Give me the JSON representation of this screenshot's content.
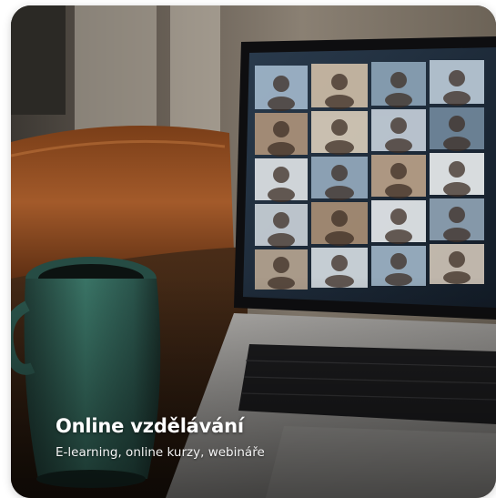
{
  "card": {
    "title": "Online vzdělávání",
    "subtitle": "E-learning, online kurzy, webináře"
  },
  "photo": {
    "subject": "laptop-video-call-with-mug",
    "colors": {
      "wall": "#5a5148",
      "chair": "#8a4a22",
      "table": "#3a2416",
      "mug": "#2f5f55",
      "laptop_body": "#9c9a97",
      "screen": "#1b2a3a",
      "keyboard": "#1c1c1e"
    }
  },
  "colors": {
    "caption_text": "#ffffff",
    "page_background": "#ffffff"
  }
}
